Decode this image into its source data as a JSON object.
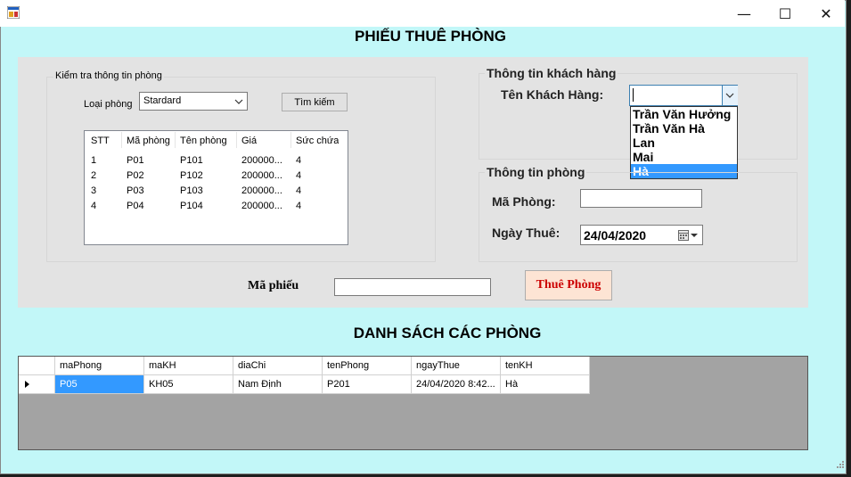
{
  "window": {
    "title": "",
    "minimize": "—",
    "maximize": "☐",
    "close": "✕"
  },
  "header": {
    "title": "PHIẾU THUÊ PHÒNG"
  },
  "room_check": {
    "group_title": "Kiểm tra thông tin phòng",
    "room_type_label": "Loại phòng",
    "room_type_value": "Stardard",
    "search_button": "Tìm kiếm",
    "columns": [
      "STT",
      "Mã phòng",
      "Tên phòng",
      "Giá",
      "Sức chứa"
    ],
    "rows": [
      [
        "1",
        "P01",
        "P101",
        "200000...",
        "4"
      ],
      [
        "2",
        "P02",
        "P102",
        "200000...",
        "4"
      ],
      [
        "3",
        "P03",
        "P103",
        "200000...",
        "4"
      ],
      [
        "4",
        "P04",
        "P104",
        "200000...",
        "4"
      ]
    ]
  },
  "customer": {
    "group_title": "Thông tin khách hàng",
    "name_label": "Tên Khách Hàng:",
    "name_value": "",
    "options": [
      "Trần Văn Hưởng",
      "Trần Văn Hà",
      "Lan",
      "Mai",
      "Hà"
    ],
    "selected_index": 4
  },
  "room_info": {
    "group_title": "Thông tin phòng",
    "room_code_label": "Mã Phòng:",
    "room_code_value": "",
    "date_label": "Ngày Thuê:",
    "date_value": "24/04/2020"
  },
  "voucher": {
    "label": "Mã phiếu",
    "value": "",
    "rent_button": "Thuê Phòng"
  },
  "list": {
    "title": "DANH SÁCH CÁC PHÒNG",
    "columns": [
      "maPhong",
      "maKH",
      "diaChi",
      "tenPhong",
      "ngayThue",
      "tenKH"
    ],
    "rows": [
      [
        "P05",
        "KH05",
        "Nam Định",
        "P201",
        "24/04/2020 8:42...",
        "Hà"
      ]
    ]
  },
  "colors": {
    "form_background": "#c2f7f8",
    "panel_background": "#e3e3e3",
    "selection": "#3399ff",
    "rent_button_text": "#cc0000",
    "rent_button_background": "#fde4d4"
  }
}
